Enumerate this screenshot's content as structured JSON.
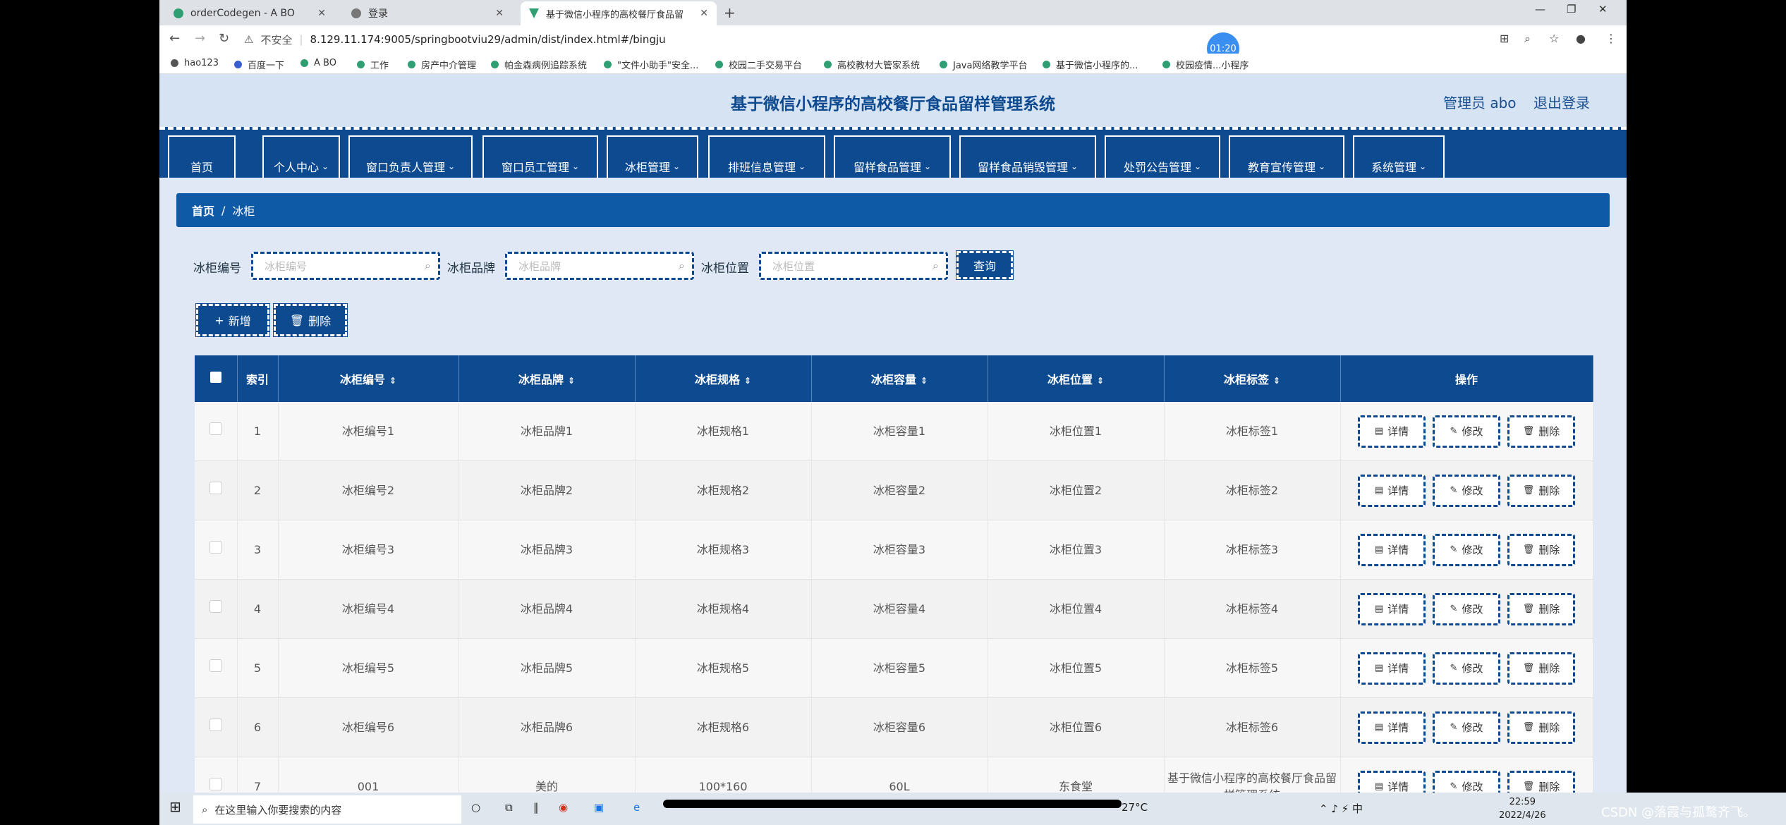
{
  "browser": {
    "tabs": [
      {
        "title": "orderCodegen - A BO"
      },
      {
        "title": "登录"
      },
      {
        "title": "基于微信小程序的高校餐厅食品留"
      }
    ],
    "url": "8.129.11.174:9005/springbootviu29/admin/dist/index.html#/bingju",
    "security_label": "不安全",
    "timer": "01:20",
    "bookmarks": [
      "hao123",
      "百度一下",
      "A BO",
      "工作",
      "房产中介管理",
      "帕金森病例追踪系统",
      "\"文件小助手\"安全...",
      "校园二手交易平台",
      "高校教材大管家系统",
      "Java网络教学平台",
      "基于微信小程序的...",
      "校园疫情...小程序"
    ]
  },
  "header": {
    "title": "基于微信小程序的高校餐厅食品留样管理系统",
    "user": "管理员 abo",
    "logout": "退出登录"
  },
  "nav": [
    "首页",
    "个人中心",
    "窗口负责人管理",
    "窗口员工管理",
    "冰柜管理",
    "排班信息管理",
    "留样食品管理",
    "留样食品销毁管理",
    "处罚公告管理",
    "教育宣传管理",
    "系统管理"
  ],
  "breadcrumb": {
    "home": "首页",
    "sep": "/",
    "current": "冰柜"
  },
  "search": {
    "fields": [
      {
        "label": "冰柜编号",
        "placeholder": "冰柜编号"
      },
      {
        "label": "冰柜品牌",
        "placeholder": "冰柜品牌"
      },
      {
        "label": "冰柜位置",
        "placeholder": "冰柜位置"
      }
    ],
    "query_button": "查询"
  },
  "actions": {
    "add": "新增",
    "delete": "删除"
  },
  "table": {
    "headers": [
      "索引",
      "冰柜编号",
      "冰柜品牌",
      "冰柜规格",
      "冰柜容量",
      "冰柜位置",
      "冰柜标签",
      "操作"
    ],
    "rows": [
      [
        "1",
        "冰柜编号1",
        "冰柜品牌1",
        "冰柜规格1",
        "冰柜容量1",
        "冰柜位置1",
        "冰柜标签1"
      ],
      [
        "2",
        "冰柜编号2",
        "冰柜品牌2",
        "冰柜规格2",
        "冰柜容量2",
        "冰柜位置2",
        "冰柜标签2"
      ],
      [
        "3",
        "冰柜编号3",
        "冰柜品牌3",
        "冰柜规格3",
        "冰柜容量3",
        "冰柜位置3",
        "冰柜标签3"
      ],
      [
        "4",
        "冰柜编号4",
        "冰柜品牌4",
        "冰柜规格4",
        "冰柜容量4",
        "冰柜位置4",
        "冰柜标签4"
      ],
      [
        "5",
        "冰柜编号5",
        "冰柜品牌5",
        "冰柜规格5",
        "冰柜容量5",
        "冰柜位置5",
        "冰柜标签5"
      ],
      [
        "6",
        "冰柜编号6",
        "冰柜品牌6",
        "冰柜规格6",
        "冰柜容量6",
        "冰柜位置6",
        "冰柜标签6"
      ],
      [
        "7",
        "001",
        "美的",
        "100*160",
        "60L",
        "东食堂",
        "基于微信小程序的高校餐厅食品留样管理系统"
      ]
    ],
    "row_actions": [
      "详情",
      "修改",
      "删除"
    ]
  },
  "taskbar": {
    "search_placeholder": "在这里输入你要搜索的内容",
    "weather": "27°C",
    "time": "22:59",
    "date": "2022/4/26",
    "watermark": "CSDN @落霞与孤鹜齐飞。"
  }
}
